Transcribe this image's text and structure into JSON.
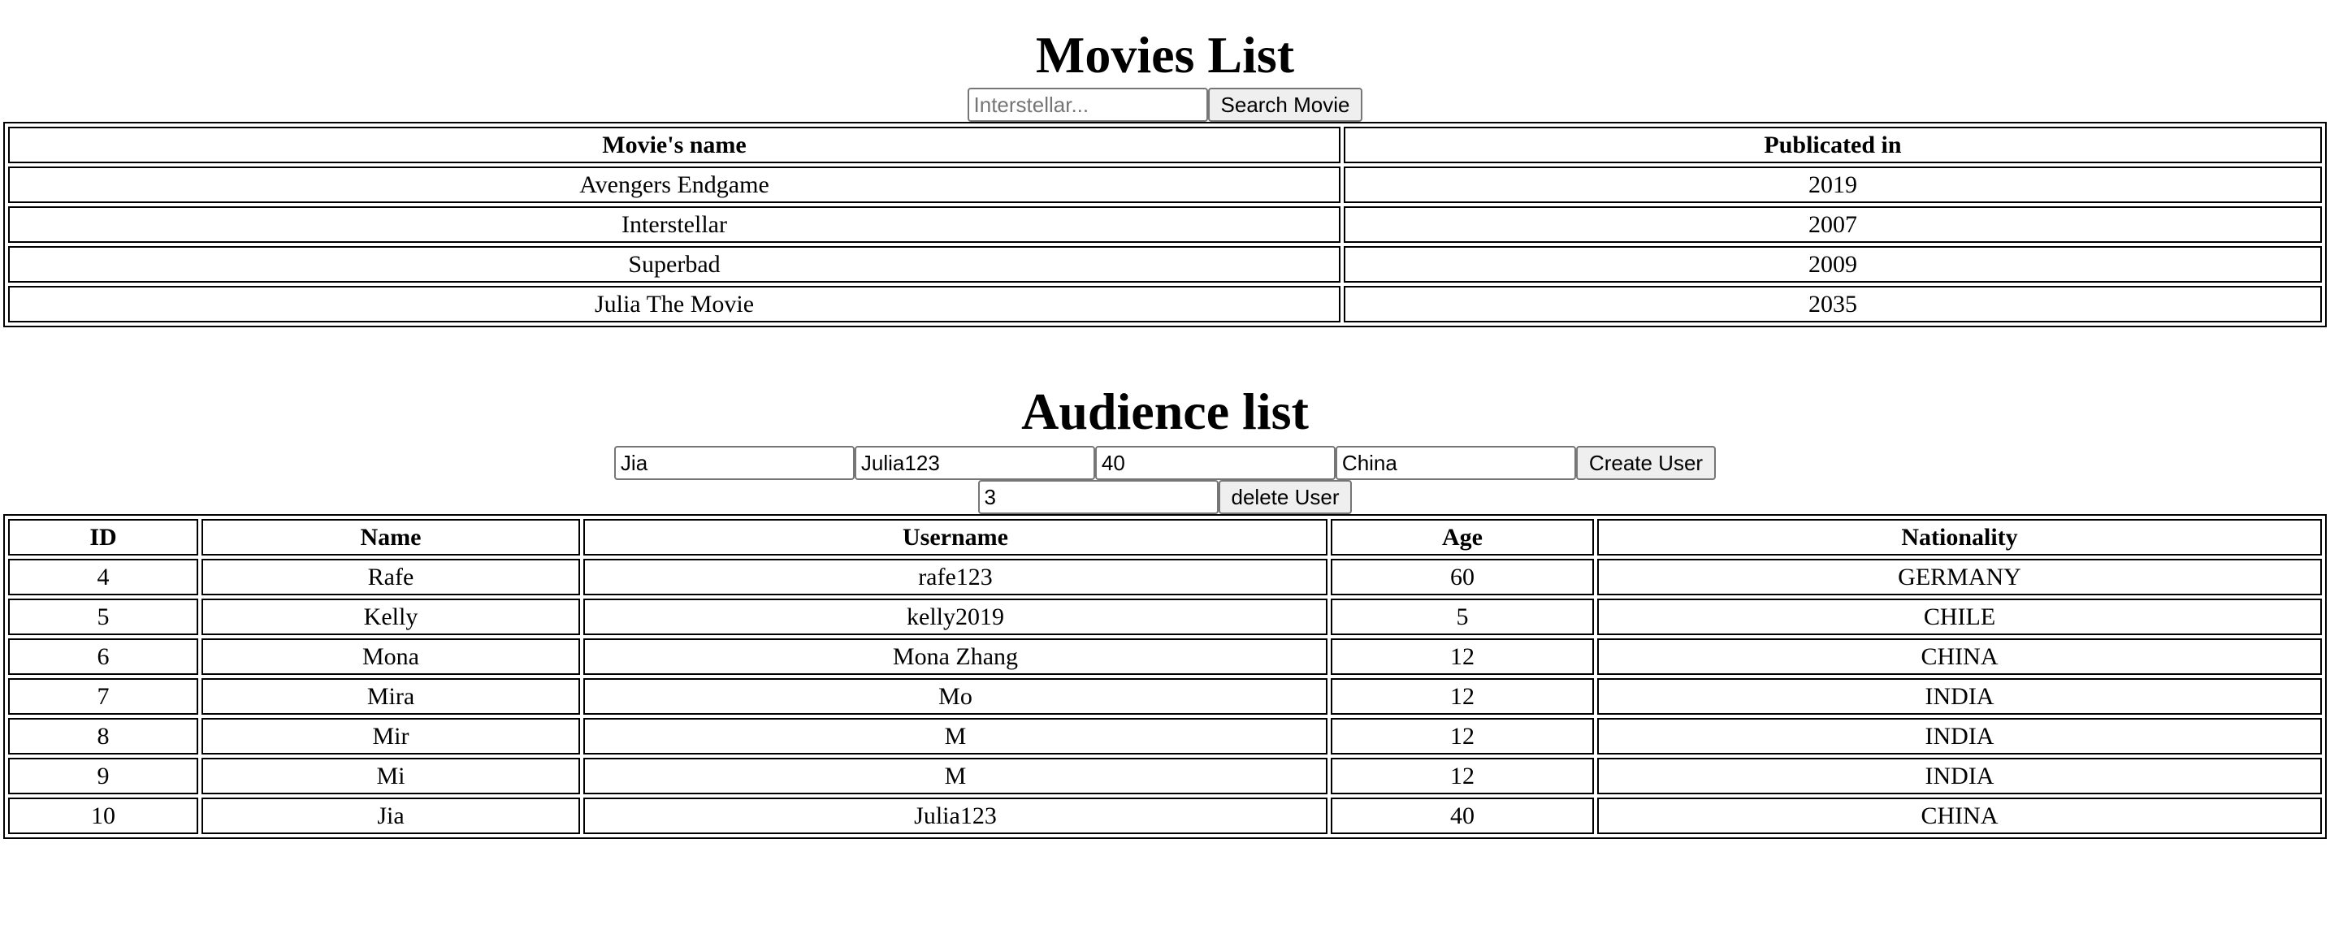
{
  "movies": {
    "title": "Movies List",
    "search_placeholder": "Interstellar...",
    "search_button": "Search Movie",
    "headers": [
      "Movie's name",
      "Publicated in"
    ],
    "rows": [
      [
        "Avengers Endgame",
        "2019"
      ],
      [
        "Interstellar",
        "2007"
      ],
      [
        "Superbad",
        "2009"
      ],
      [
        "Julia The Movie",
        "2035"
      ]
    ]
  },
  "audience": {
    "title": "Audience list",
    "create_form": {
      "name_value": "Jia",
      "username_value": "Julia123",
      "age_value": "40",
      "nationality_value": "China",
      "create_button": "Create User"
    },
    "delete_form": {
      "id_value": "3",
      "delete_button": "delete User"
    },
    "headers": [
      "ID",
      "Name",
      "Username",
      "Age",
      "Nationality"
    ],
    "rows": [
      [
        "4",
        "Rafe",
        "rafe123",
        "60",
        "GERMANY"
      ],
      [
        "5",
        "Kelly",
        "kelly2019",
        "5",
        "CHILE"
      ],
      [
        "6",
        "Mona",
        "Mona Zhang",
        "12",
        "CHINA"
      ],
      [
        "7",
        "Mira",
        "Mo",
        "12",
        "INDIA"
      ],
      [
        "8",
        "Mir",
        "M",
        "12",
        "INDIA"
      ],
      [
        "9",
        "Mi",
        "M",
        "12",
        "INDIA"
      ],
      [
        "10",
        "Jia",
        "Julia123",
        "40",
        "CHINA"
      ]
    ]
  }
}
